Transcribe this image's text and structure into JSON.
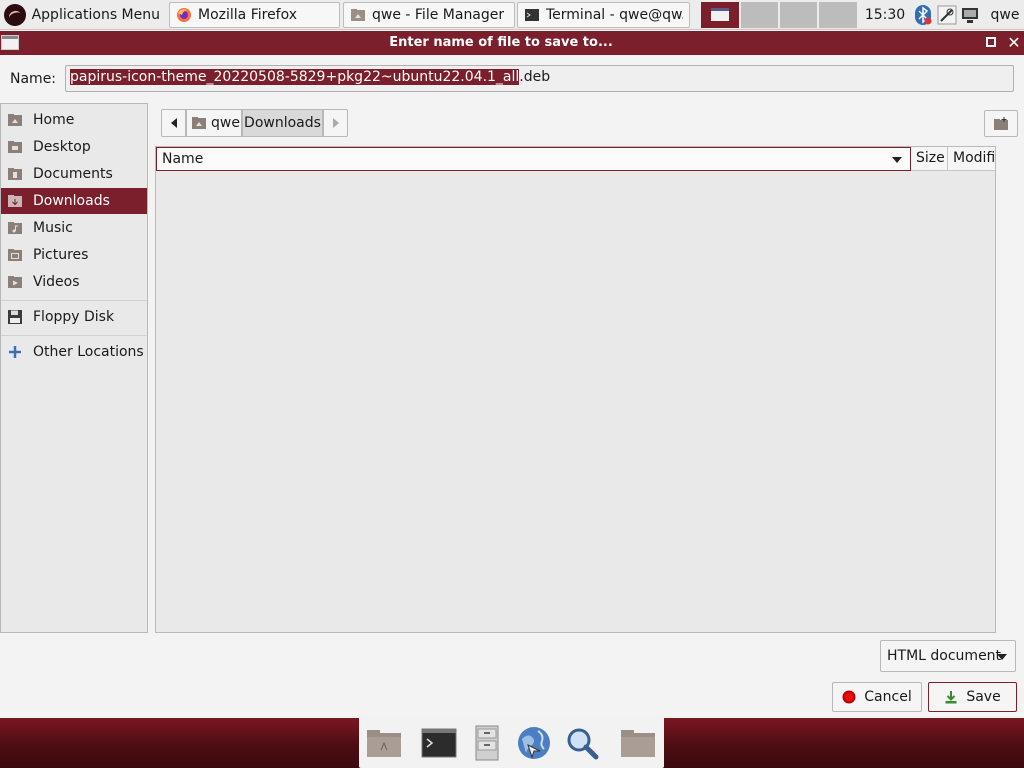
{
  "top_panel": {
    "apps_menu_label": "Applications Menu",
    "tasks": [
      {
        "label": "Mozilla Firefox",
        "icon": "firefox-icon"
      },
      {
        "label": "qwe - File Manager",
        "icon": "file-manager-icon"
      },
      {
        "label": "Terminal - qwe@qw...",
        "icon": "terminal-icon"
      }
    ],
    "workspaces": 4,
    "active_workspace": 1,
    "clock": "15:30",
    "tray_icons": [
      "bluetooth-icon",
      "network-icon",
      "display-icon"
    ],
    "user": "qwe"
  },
  "dialog": {
    "title": "Enter name of file to save to...",
    "name_label": "Name:",
    "filename_selected": "papirus-icon-theme_20220508-5829+pkg22~ubuntu22.04.1_all",
    "filename_ext": ".deb",
    "places": [
      {
        "label": "Home",
        "icon": "home-folder-icon"
      },
      {
        "label": "Desktop",
        "icon": "desktop-folder-icon"
      },
      {
        "label": "Documents",
        "icon": "documents-folder-icon"
      },
      {
        "label": "Downloads",
        "icon": "downloads-folder-icon",
        "active": true
      },
      {
        "label": "Music",
        "icon": "music-folder-icon"
      },
      {
        "label": "Pictures",
        "icon": "pictures-folder-icon"
      },
      {
        "label": "Videos",
        "icon": "videos-folder-icon"
      }
    ],
    "devices": [
      {
        "label": "Floppy Disk",
        "icon": "floppy-disk-icon"
      }
    ],
    "other_locations_label": "Other Locations",
    "path": [
      "qwe",
      "Downloads"
    ],
    "columns": [
      "Name",
      "Size",
      "Modified"
    ],
    "file_type": "HTML document",
    "cancel_label": "Cancel",
    "save_label": "Save"
  },
  "dock": [
    "file-manager-icon",
    "terminal-icon",
    "file-cabinet-icon",
    "web-browser-icon",
    "search-icon",
    "folder-icon"
  ],
  "colors": {
    "accent": "#7a1f2b",
    "panel": "#ececec",
    "bg": "#f3f3f3"
  }
}
